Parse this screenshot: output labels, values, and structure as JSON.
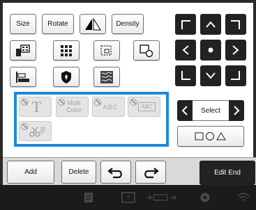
{
  "toolbar": {
    "size_label": "Size",
    "rotate_label": "Rotate",
    "density_label": "Density"
  },
  "tools": {
    "multi_color_line1": "Multi",
    "multi_color_line2": "Color",
    "text_sample": "T",
    "abc_sample": "ABC",
    "abc_boxed_sample": "ABC"
  },
  "select": {
    "label": "Select"
  },
  "actions": {
    "add_label": "Add",
    "delete_label": "Delete",
    "edit_end_label": "Edit End"
  },
  "colors": {
    "selection_frame": "#1d8ad8"
  }
}
